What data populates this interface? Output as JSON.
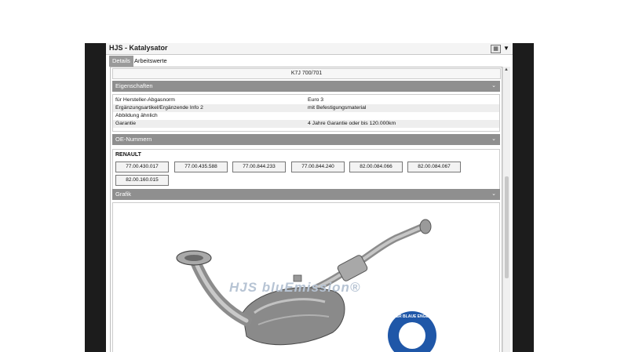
{
  "window": {
    "title": "HJS - Katalysator"
  },
  "tabs": [
    {
      "label": "Details",
      "active": true
    },
    {
      "label": "Arbeitswerte",
      "active": false
    }
  ],
  "header_value": "K7J 700/701",
  "sections": {
    "eigenschaften": "Eigenschaften",
    "oe": "OE-Nummern",
    "grafik": "Grafik"
  },
  "properties": [
    {
      "key": "für Hersteller-Abgasnorm",
      "value": "Euro 3"
    },
    {
      "key": "Ergänzungsartikel/Ergänzende Info 2",
      "value": "mit Befestigungsmaterial"
    },
    {
      "key": "Abbildung ähnlich",
      "value": ""
    },
    {
      "key": "Garantie",
      "value": "4 Jahre Garantie oder bis 120.000km"
    }
  ],
  "oe_numbers": {
    "manufacturer": "RENAULT",
    "numbers": [
      "77.00.430.017",
      "77.00.435.588",
      "77.00.844.233",
      "77.00.844.240",
      "82.00.084.066",
      "82.00.084.067",
      "82.00.160.015"
    ]
  },
  "image": {
    "watermark": "HJS bluEmission®",
    "emblem_text": "DER BLAUE ENGEL"
  },
  "colors": {
    "section_bar": "#8f8f8f",
    "side_bars": "#1c1c1c",
    "emblem_blue": "#1f57a8"
  }
}
